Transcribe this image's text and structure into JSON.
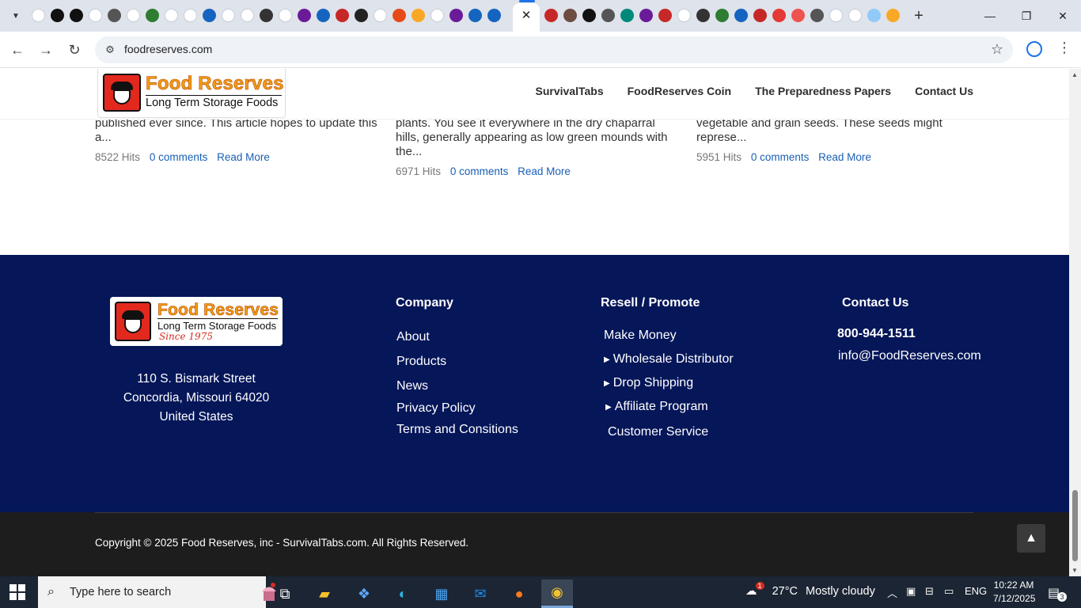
{
  "browser": {
    "url": "foodreserves.com",
    "tab_close": "✕",
    "new_tab": "+",
    "window_controls": {
      "minimize": "—",
      "maximize": "❐",
      "close": "✕"
    }
  },
  "header": {
    "logo_title": "Food Reserves",
    "logo_subtitle": "Long Term Storage Foods",
    "nav": [
      "SurvivalTabs",
      "FoodReserves Coin",
      "The Preparedness Papers",
      "Contact Us"
    ]
  },
  "articles": [
    {
      "excerpt": "published ever since. This article hopes to update this a...",
      "hits": "8522 Hits",
      "comments": "0 comments",
      "read_more": "Read More"
    },
    {
      "excerpt": "plants. You see it everywhere in the dry chaparral hills, generally appearing as low green mounds with the...",
      "hits": "6971 Hits",
      "comments": "0 comments",
      "read_more": "Read More"
    },
    {
      "excerpt": "vegetable and grain seeds. These seeds might represe...",
      "hits": "5951 Hits",
      "comments": "0 comments",
      "read_more": "Read More"
    }
  ],
  "footer": {
    "logo_title": "Food Reserves",
    "logo_subtitle": "Long Term Storage Foods",
    "logo_since": "Since 1975",
    "address": [
      "110 S. Bismark Street",
      "Concordia, Missouri 64020",
      "United States"
    ],
    "company": {
      "heading": "Company",
      "links": [
        "About",
        "Products",
        "News",
        "Privacy Policy",
        "Terms and Consitions"
      ]
    },
    "resell": {
      "heading": "Resell / Promote",
      "links": [
        "Make Money",
        "Wholesale Distributor",
        "Drop Shipping",
        "Affiliate Program",
        "Customer Service"
      ]
    },
    "contact": {
      "heading": "Contact Us",
      "phone": "800-944-1511",
      "email": "info@FoodReserves.com"
    },
    "copyright": "Copyright © 2025 Food Reserves, inc - SurvivalTabs.com. All Rights Reserved."
  },
  "taskbar": {
    "search_placeholder": "Type here to search",
    "weather_temp": "27°C",
    "weather_desc": "Mostly cloudy",
    "weather_badge": "1",
    "language": "ENG",
    "time": "10:22 AM",
    "date": "7/12/2025",
    "notification_count": "3"
  },
  "colors": {
    "footer_bg": "#051659",
    "bottom_bg": "#1d1d1d",
    "link": "#1a5fb4",
    "logo_orange": "#f39c12",
    "logo_red": "#e3281e"
  }
}
